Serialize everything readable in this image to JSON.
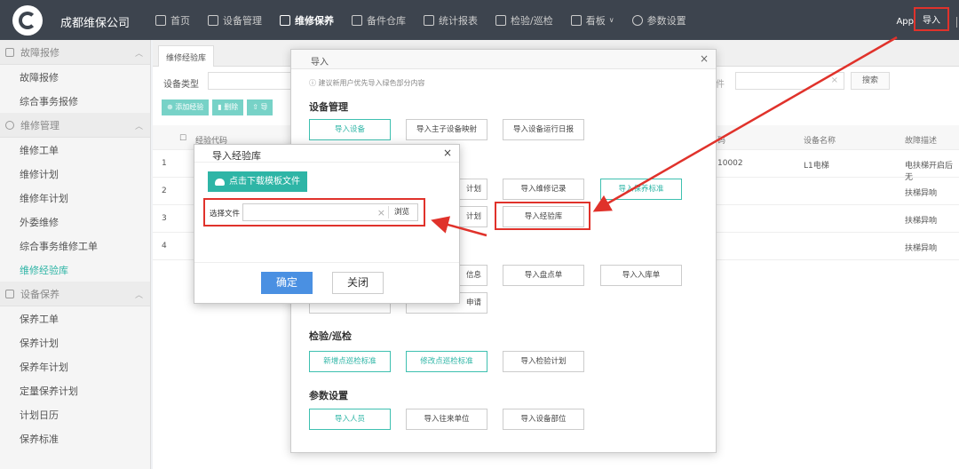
{
  "header": {
    "company": "成都维保公司",
    "nav": [
      {
        "label": "首页",
        "icon": "home-icon"
      },
      {
        "label": "设备管理",
        "icon": "tools-icon"
      },
      {
        "label": "维修保养",
        "icon": "gears-icon",
        "active": true
      },
      {
        "label": "备件仓库",
        "icon": "warehouse-icon"
      },
      {
        "label": "统计报表",
        "icon": "chart-icon"
      },
      {
        "label": "检验/巡检",
        "icon": "inspect-icon"
      },
      {
        "label": "看板",
        "icon": "board-icon"
      },
      {
        "label": "参数设置",
        "icon": "settings-icon"
      }
    ],
    "app_label": "App",
    "import_label": "导入"
  },
  "sidebar": {
    "groups": [
      {
        "title": "故障报修",
        "items": [
          "故障报修",
          "综合事务报修"
        ]
      },
      {
        "title": "维修管理",
        "items": [
          "维修工单",
          "维修计划",
          "维修年计划",
          "外委维修",
          "综合事务维修工单",
          "维修经验库"
        ]
      },
      {
        "title": "设备保养",
        "items": [
          "保养工单",
          "保养计划",
          "保养年计划",
          "定量保养计划",
          "计划日历",
          "保养标准"
        ]
      }
    ]
  },
  "main": {
    "tab_label": "维修经验库",
    "filter_label": "设备类型",
    "filter_label2": "件",
    "search_label": "搜索",
    "toolbar": [
      "添加经验",
      "删除",
      "导"
    ],
    "columns": [
      "经验代码",
      "码",
      "设备名称",
      "故障描述"
    ],
    "rows": [
      {
        "idx": "1",
        "code": "10002",
        "name": "L1电梯",
        "desc": "电扶梯开启后无"
      },
      {
        "idx": "2",
        "code": "",
        "name": "",
        "desc": "扶梯异响"
      },
      {
        "idx": "3",
        "code": "",
        "name": "",
        "desc": "扶梯异响"
      },
      {
        "idx": "4",
        "code": "",
        "name": "",
        "desc": "扶梯异响"
      }
    ]
  },
  "import_modal": {
    "title": "导入",
    "tip": "建议新用户优先导入绿色部分内容",
    "sections": {
      "device": "设备管理",
      "inspect": "检验/巡检",
      "params": "参数设置"
    },
    "buttons": {
      "import_device": "导入设备",
      "import_main_sub": "导入主子设备映射",
      "import_daily": "导入设备运行日报",
      "plan": "计划",
      "import_repair_record": "导入维修记录",
      "import_maintain_std": "导入保养标准",
      "plan2": "计划",
      "import_experience": "导入经验库",
      "info": "信息",
      "import_stocktake": "导入盘点单",
      "import_inbound": "导入入库单",
      "apply": "申请",
      "add_inspect_std": "新增点巡检标准",
      "edit_inspect_std": "修改点巡检标准",
      "import_inspect_plan": "导入检验计划",
      "import_staff": "导入人员",
      "import_partner": "导入往来单位",
      "import_part": "导入设备部位"
    }
  },
  "exp_modal": {
    "title": "导入经验库",
    "download_label": "点击下载模板文件",
    "file_label": "选择文件",
    "file_value": "",
    "browse_label": "浏览",
    "ok_label": "确定",
    "close_label": "关闭"
  },
  "colors": {
    "header_bg": "#3d444e",
    "accent": "#2eb5a6",
    "primary": "#4a90e2",
    "annotation": "#e0322b"
  }
}
